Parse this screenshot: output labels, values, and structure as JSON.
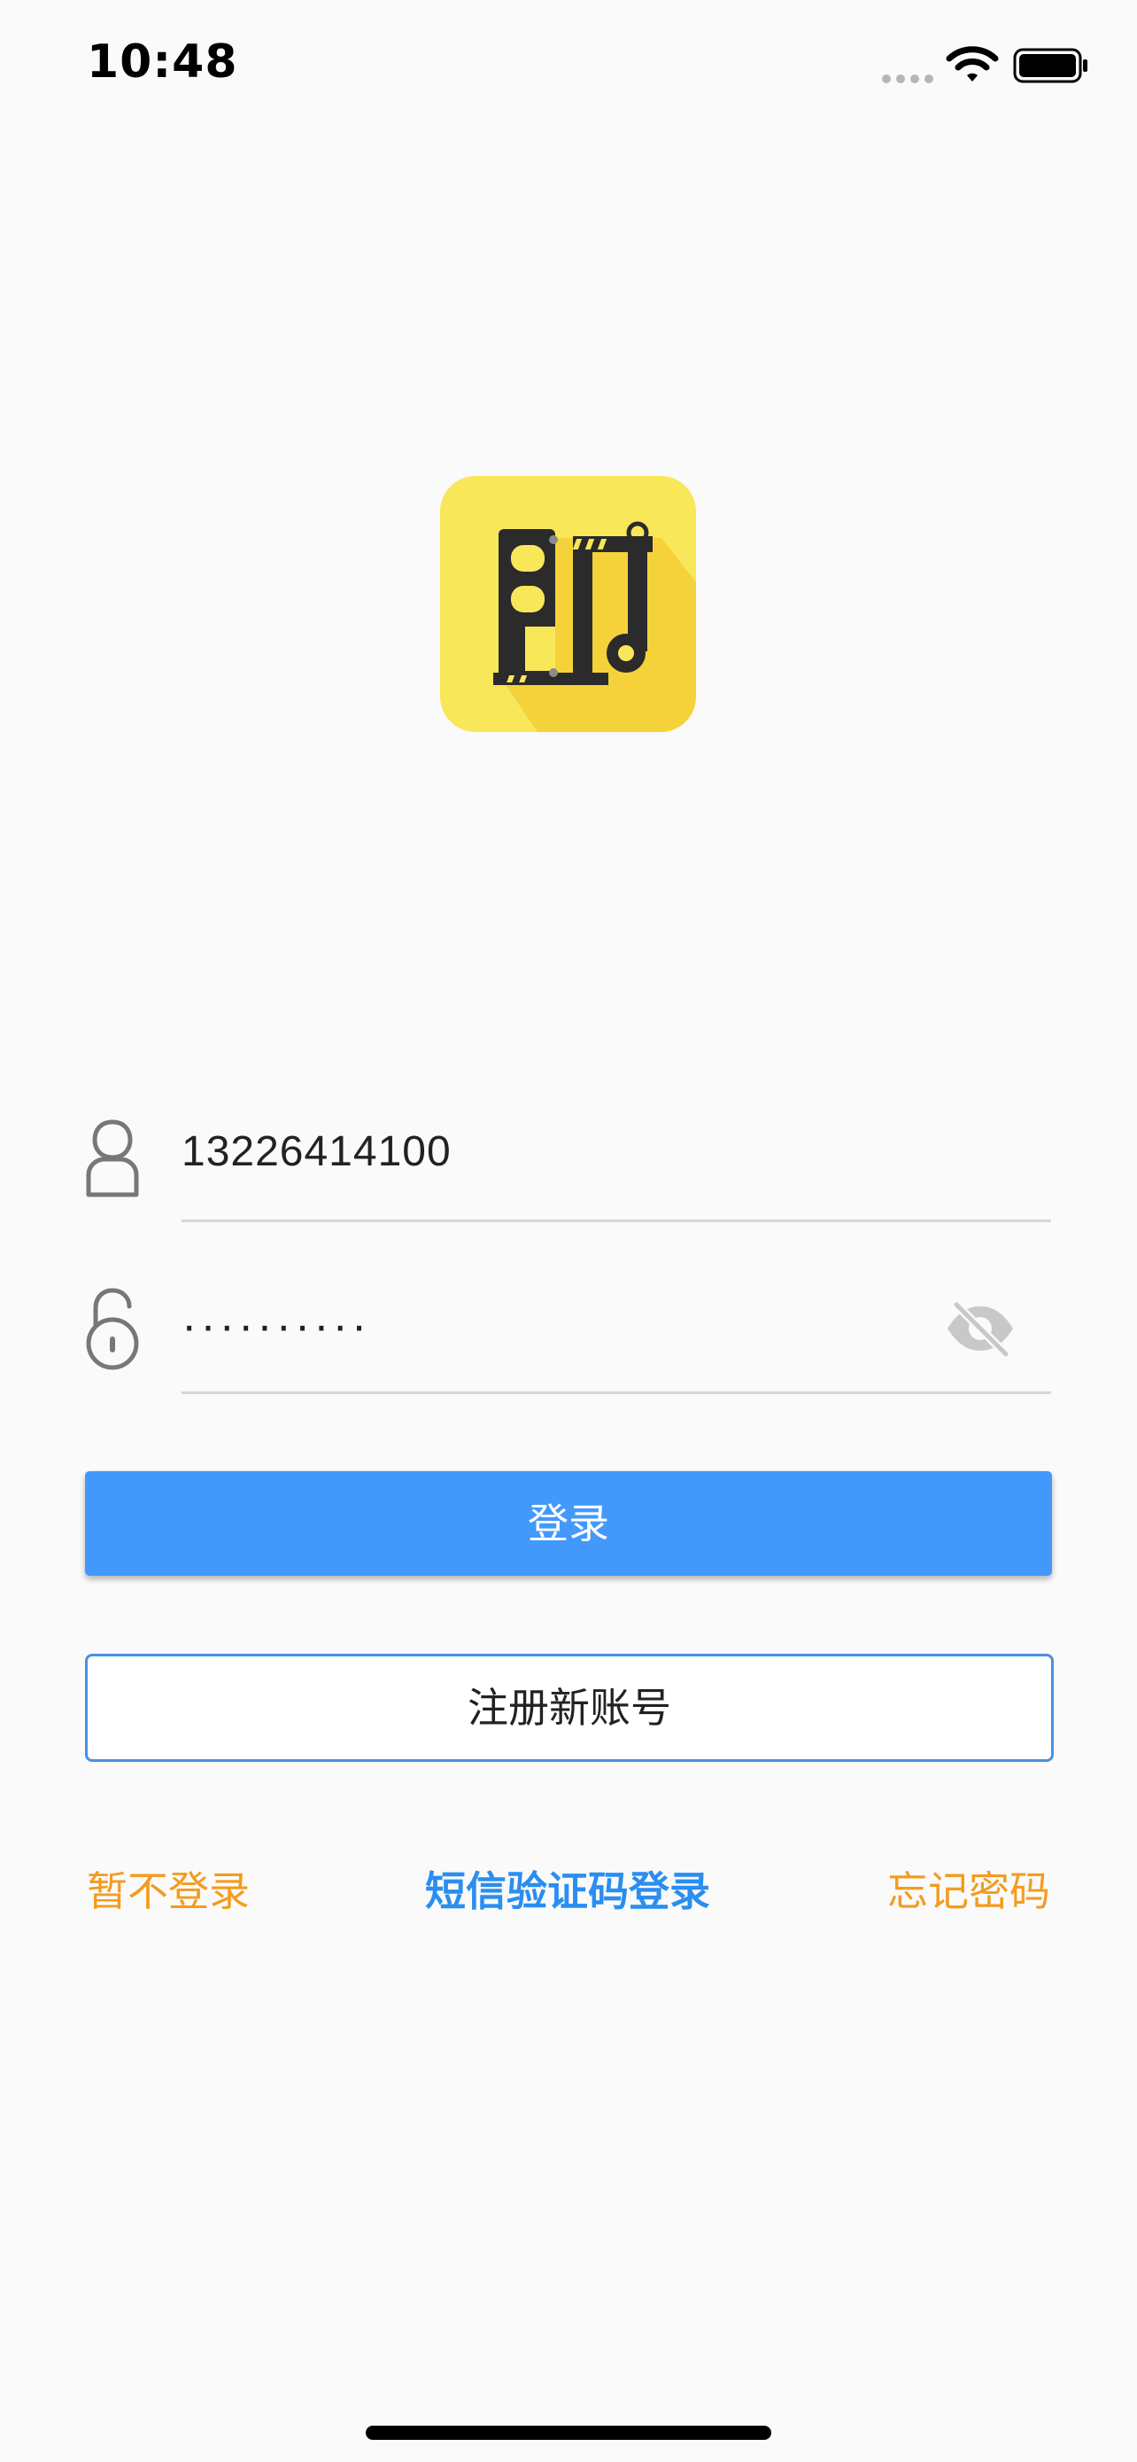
{
  "status_bar": {
    "time": "10:48"
  },
  "login_form": {
    "phone_value": "13226414100",
    "password_masked": "··········"
  },
  "buttons": {
    "login_label": "登录",
    "register_label": "注册新账号"
  },
  "links": {
    "skip_login": "暂不登录",
    "sms_login": "短信验证码登录",
    "forgot_password": "忘记密码"
  },
  "icons": {
    "user": "user-icon",
    "lock": "lock-open-icon",
    "visibility": "eye-off-icon",
    "wifi": "wifi-icon",
    "battery": "battery-icon"
  },
  "colors": {
    "primary": "#4299fb",
    "link_orange": "#f39c1f",
    "link_blue": "#2a8ef0",
    "logo_bg": "#f9e75a"
  }
}
